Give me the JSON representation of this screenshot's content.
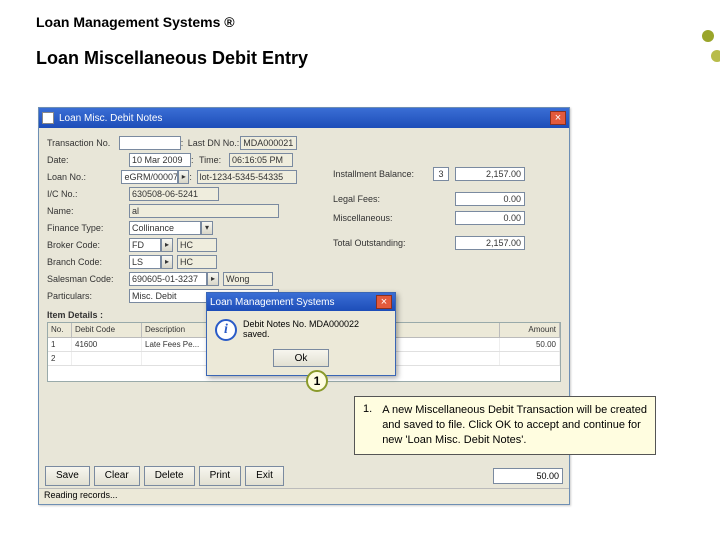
{
  "header": {
    "app_title": "Loan Management Systems ®",
    "page_title": "Loan Miscellaneous Debit Entry"
  },
  "window": {
    "title": "Loan Misc. Debit Notes",
    "fields": {
      "transaction_no_lbl": "Transaction No.",
      "transaction_no": "",
      "last_dn_lbl": "Last DN No.:",
      "last_dn": "MDA000021",
      "date_lbl": "Date:",
      "date": "10 Mar 2009",
      "time_lbl": "Time:",
      "time": "06:16:05 PM",
      "loan_no_lbl": "Loan No.:",
      "loan_no": "eGRM/00007",
      "loan_ref": "lot-1234-5345-54335",
      "hc_no_lbl": "I/C No.:",
      "hc_no": "630508-06-5241",
      "name_lbl": "Name:",
      "name": "al",
      "finance_type_lbl": "Finance Type:",
      "finance_type": "Collinance",
      "broker_code_lbl": "Broker Code:",
      "broker_code": "FD",
      "broker_desc": "HC",
      "branch_code_lbl": "Branch Code:",
      "branch_code": "LS",
      "branch_desc": "HC",
      "salesman_code_lbl": "Salesman Code:",
      "salesman_code": "690605-01-3237",
      "salesman_desc": "Wong",
      "particulars_lbl": "Particulars:",
      "particulars": "Misc. Debit"
    },
    "right": {
      "installment_lbl": "Installment Balance:",
      "installment_num": "3",
      "installment_val": "2,157.00",
      "legal_fees_lbl": "Legal Fees:",
      "legal_fees_val": "0.00",
      "misc_lbl": "Miscellaneous:",
      "misc_val": "0.00",
      "total_out_lbl": "Total Outstanding:",
      "total_out_val": "2,157.00"
    },
    "grid": {
      "section_lbl": "Item Details :",
      "headers": {
        "no": "No.",
        "debit_code": "Debit Code",
        "desc": "Description",
        "amount": "Amount"
      },
      "rows": [
        {
          "no": "1",
          "debit_code": "41600",
          "desc": "Late Fees Pe...",
          "amount": "50.00"
        },
        {
          "no": "2",
          "debit_code": "",
          "desc": "",
          "amount": ""
        }
      ]
    },
    "total_val": "50.00",
    "buttons": {
      "save": "Save",
      "clear": "Clear",
      "delete": "Delete",
      "print": "Print",
      "exit": "Exit"
    },
    "status": "Reading records..."
  },
  "msgbox": {
    "title": "Loan Management Systems",
    "text": "Debit Notes No. MDA000022 saved.",
    "ok": "Ok"
  },
  "callout": {
    "num": "1"
  },
  "instruction": {
    "num": "1.",
    "text": "A new Miscellaneous Debit Transaction will be created and saved to file. Click OK to accept and continue for new 'Loan Misc. Debit Notes'."
  },
  "decor_colors": [
    "#9aa52a",
    "#cfd06a",
    "#e5e59a",
    "#f1f1c8",
    "#b8bc4a",
    "#d6d88a"
  ]
}
